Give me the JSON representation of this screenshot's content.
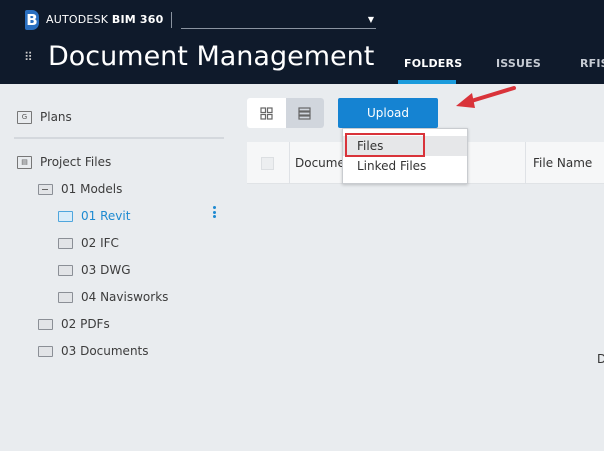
{
  "header": {
    "brand_prefix": "AUTODESK",
    "brand_product": "BIM 360",
    "project_selector": "",
    "title": "Document Management",
    "tabs": [
      {
        "label": "FOLDERS",
        "active": true
      },
      {
        "label": "ISSUES"
      },
      {
        "label": "RFIS"
      }
    ]
  },
  "sidebar": {
    "plans": "Plans",
    "project_files": "Project Files",
    "folders": [
      {
        "label": "01 Models",
        "level": 1,
        "expanded": true
      },
      {
        "label": "01 Revit",
        "level": 2,
        "selected": true
      },
      {
        "label": "02 IFC",
        "level": 2
      },
      {
        "label": "03 DWG",
        "level": 2
      },
      {
        "label": "04 Navisworks",
        "level": 2
      },
      {
        "label": "02 PDFs",
        "level": 1
      },
      {
        "label": "03 Documents",
        "level": 1
      }
    ]
  },
  "toolbar": {
    "upload_label": "Upload"
  },
  "upload_menu": {
    "items": [
      "Files",
      "Linked Files"
    ],
    "highlighted": "Files"
  },
  "table": {
    "columns": [
      "Documen",
      "File Name"
    ]
  },
  "partial_text": "D",
  "colors": {
    "header_bg": "#0f1a2b",
    "accent": "#1583d2",
    "selected": "#1d8ad1",
    "annotation": "#d9333a"
  }
}
